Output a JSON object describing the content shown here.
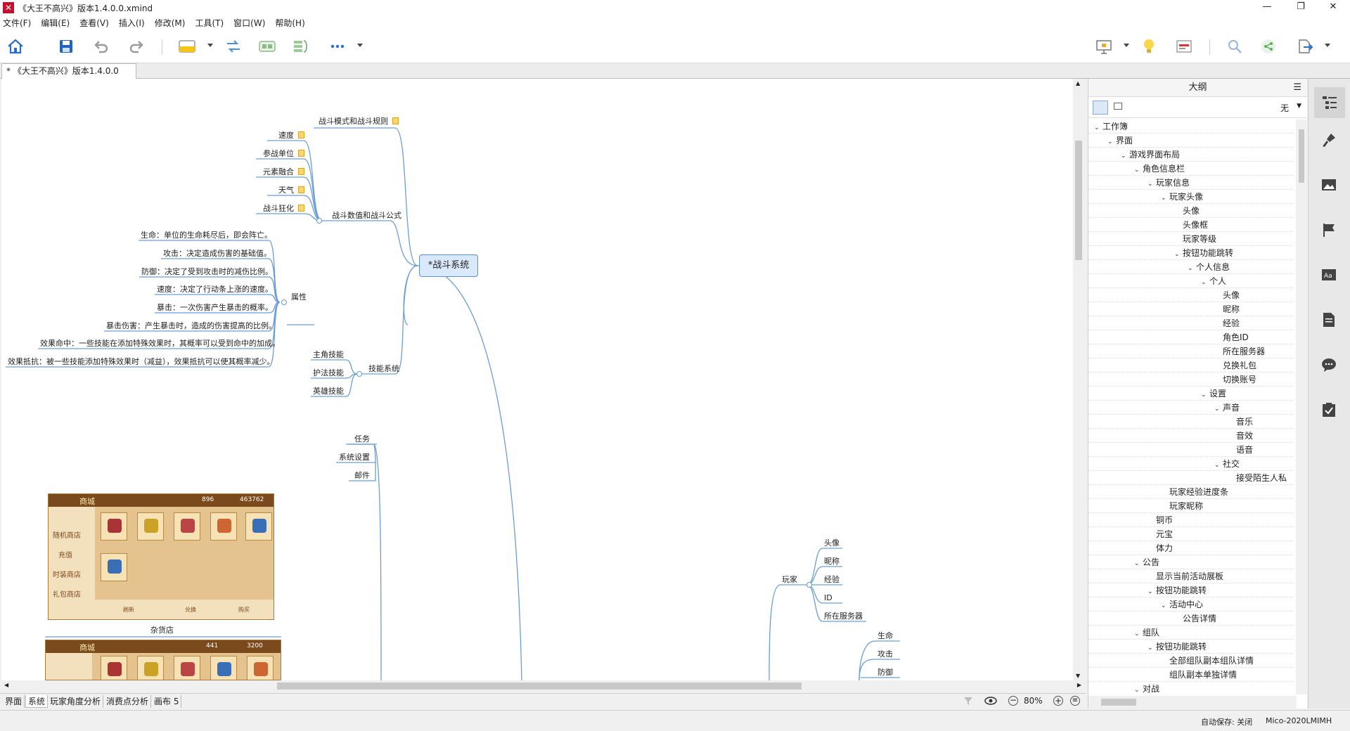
{
  "window": {
    "title": "《大王不高兴》版本1.4.0.0.xmind",
    "minimize": "—",
    "maximize": "❐",
    "close": "✕"
  },
  "menu": [
    "文件(F)",
    "编辑(E)",
    "查看(V)",
    "插入(I)",
    "修改(M)",
    "工具(T)",
    "窗口(W)",
    "帮助(H)"
  ],
  "doc_tab": "* 《大王不高兴》版本1.4.0.0",
  "mindmap": {
    "central": "*战斗系统",
    "battle_mode": "战斗模式和战斗规则",
    "battle_formula": "战斗数值和战斗公式",
    "formula_children": [
      "速度",
      "参战单位",
      "元素融合",
      "天气",
      "战斗狂化"
    ],
    "attributes": "属性",
    "attribute_children": [
      "生命：单位的生命耗尽后，即会阵亡。",
      "攻击：决定造成伤害的基础值。",
      "防御：决定了受到攻击时的减伤比例。",
      "速度：决定了行动条上涨的速度。",
      "暴击：一次伤害产生暴击的概率。",
      "暴击伤害：产生暴击时，造成的伤害提高的比例。",
      "效果命中：一些技能在添加特殊效果时，其概率可以受到命中的加成。",
      "效果抵抗：被一些技能添加特殊效果时（减益），效果抵抗可以使其概率减少。"
    ],
    "skills": "技能系统",
    "skill_children": [
      "主角技能",
      "护法技能",
      "英雄技能"
    ],
    "misc": [
      "任务",
      "系统设置",
      "邮件"
    ],
    "shop_caption": "杂货店",
    "player": "玩家",
    "player_children": [
      "头像",
      "昵称",
      "经验",
      "ID",
      "所在服务器"
    ],
    "stat_children": [
      "生命",
      "攻击",
      "防御"
    ],
    "thumb1": {
      "title": "商城",
      "side": [
        "随机商店",
        "充值",
        "时装商店",
        "礼包商店"
      ],
      "currency1": "896",
      "currency2": "463762",
      "buttons": [
        "刷新",
        "兑换",
        "购买"
      ]
    },
    "thumb2": {
      "title": "商城",
      "currency1": "441",
      "currency2": "3200"
    }
  },
  "sheet_tabs": [
    "界面",
    "系统",
    "玩家角度分析",
    "消费点分析",
    "画布 5"
  ],
  "active_sheet": "系统",
  "zoom": "80%",
  "outline": {
    "title": "大纲",
    "filter": "无",
    "rows": [
      {
        "d": 0,
        "t": "工作簿",
        "e": true
      },
      {
        "d": 1,
        "t": "界面",
        "e": true
      },
      {
        "d": 2,
        "t": "游戏界面布局",
        "e": true
      },
      {
        "d": 3,
        "t": "角色信息栏",
        "e": true
      },
      {
        "d": 4,
        "t": "玩家信息",
        "e": true
      },
      {
        "d": 5,
        "t": "玩家头像",
        "e": true
      },
      {
        "d": 6,
        "t": "头像",
        "e": false
      },
      {
        "d": 6,
        "t": "头像框",
        "e": false
      },
      {
        "d": 6,
        "t": "玩家等级",
        "e": false
      },
      {
        "d": 6,
        "t": "按钮功能跳转",
        "e": true
      },
      {
        "d": 7,
        "t": "个人信息",
        "e": true
      },
      {
        "d": 8,
        "t": "个人",
        "e": true
      },
      {
        "d": 9,
        "t": "头像",
        "e": false
      },
      {
        "d": 9,
        "t": "昵称",
        "e": false
      },
      {
        "d": 9,
        "t": "经验",
        "e": false
      },
      {
        "d": 9,
        "t": "角色ID",
        "e": false
      },
      {
        "d": 9,
        "t": "所在服务器",
        "e": false
      },
      {
        "d": 9,
        "t": "兑换礼包",
        "e": false
      },
      {
        "d": 9,
        "t": "切换账号",
        "e": false
      },
      {
        "d": 8,
        "t": "设置",
        "e": true
      },
      {
        "d": 9,
        "t": "声音",
        "e": true
      },
      {
        "d": 10,
        "t": "音乐",
        "e": false
      },
      {
        "d": 10,
        "t": "音效",
        "e": false
      },
      {
        "d": 10,
        "t": "语音",
        "e": false
      },
      {
        "d": 9,
        "t": "社交",
        "e": true
      },
      {
        "d": 10,
        "t": "接受陌生人私",
        "e": false
      },
      {
        "d": 5,
        "t": "玩家经验进度条",
        "e": false
      },
      {
        "d": 5,
        "t": "玩家昵称",
        "e": false
      },
      {
        "d": 4,
        "t": "铜币",
        "e": false
      },
      {
        "d": 4,
        "t": "元宝",
        "e": false
      },
      {
        "d": 4,
        "t": "体力",
        "e": false
      },
      {
        "d": 3,
        "t": "公告",
        "e": true
      },
      {
        "d": 4,
        "t": "显示当前活动展板",
        "e": false
      },
      {
        "d": 4,
        "t": "按钮功能跳转",
        "e": true
      },
      {
        "d": 5,
        "t": "活动中心",
        "e": true
      },
      {
        "d": 6,
        "t": "公告详情",
        "e": false
      },
      {
        "d": 3,
        "t": "组队",
        "e": true
      },
      {
        "d": 4,
        "t": "按钮功能跳转",
        "e": true
      },
      {
        "d": 5,
        "t": "全部组队副本组队详情",
        "e": false
      },
      {
        "d": 5,
        "t": "组队副本单独详情",
        "e": false
      },
      {
        "d": 3,
        "t": "对战",
        "e": true
      }
    ]
  },
  "status": {
    "autosave": "自动保存: 关闭",
    "user": "Mico-2020LMIMH"
  }
}
